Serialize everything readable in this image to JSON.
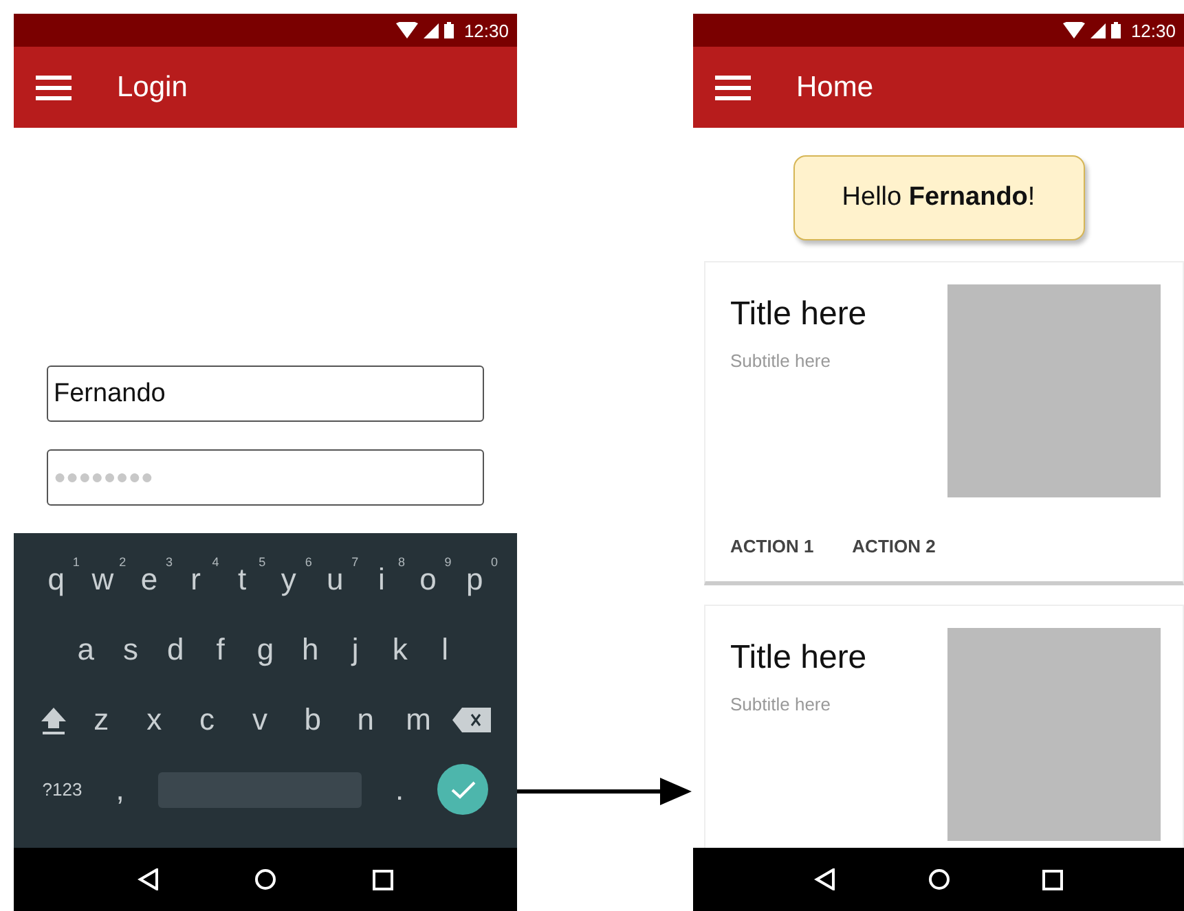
{
  "login_screen": {
    "status_bar": {
      "time": "12:30"
    },
    "app_bar": {
      "title": "Login"
    },
    "username_field": {
      "value": "Fernando"
    },
    "password_field": {
      "value": "●●●●●●●●"
    },
    "keyboard": {
      "rows": [
        {
          "keys": [
            {
              "label": "q",
              "hint": "1"
            },
            {
              "label": "w",
              "hint": "2"
            },
            {
              "label": "e",
              "hint": "3"
            },
            {
              "label": "r",
              "hint": "4"
            },
            {
              "label": "t",
              "hint": "5"
            },
            {
              "label": "y",
              "hint": "6"
            },
            {
              "label": "u",
              "hint": "7"
            },
            {
              "label": "i",
              "hint": "8"
            },
            {
              "label": "o",
              "hint": "9"
            },
            {
              "label": "p",
              "hint": "0"
            }
          ]
        },
        {
          "keys": [
            {
              "label": "a"
            },
            {
              "label": "s"
            },
            {
              "label": "d"
            },
            {
              "label": "f"
            },
            {
              "label": "g"
            },
            {
              "label": "h"
            },
            {
              "label": "j"
            },
            {
              "label": "k"
            },
            {
              "label": "l"
            }
          ]
        },
        {
          "keys": [
            {
              "kind": "shift"
            },
            {
              "label": "z"
            },
            {
              "label": "x"
            },
            {
              "label": "c"
            },
            {
              "label": "v"
            },
            {
              "label": "b"
            },
            {
              "label": "n"
            },
            {
              "label": "m"
            },
            {
              "kind": "backspace"
            }
          ]
        },
        {
          "keys": [
            {
              "kind": "symbols",
              "label": "?123"
            },
            {
              "label": ","
            },
            {
              "kind": "space"
            },
            {
              "label": "."
            },
            {
              "kind": "done"
            }
          ]
        }
      ]
    }
  },
  "home_screen": {
    "status_bar": {
      "time": "12:30"
    },
    "app_bar": {
      "title": "Home"
    },
    "greeting": "Hello **Fernando**!",
    "cards": [
      {
        "title": "Title here",
        "subtitle": "Subtitle here",
        "actions": [
          "ACTION 1",
          "ACTION 2"
        ]
      },
      {
        "title": "Title here",
        "subtitle": "Subtitle here"
      }
    ]
  }
}
